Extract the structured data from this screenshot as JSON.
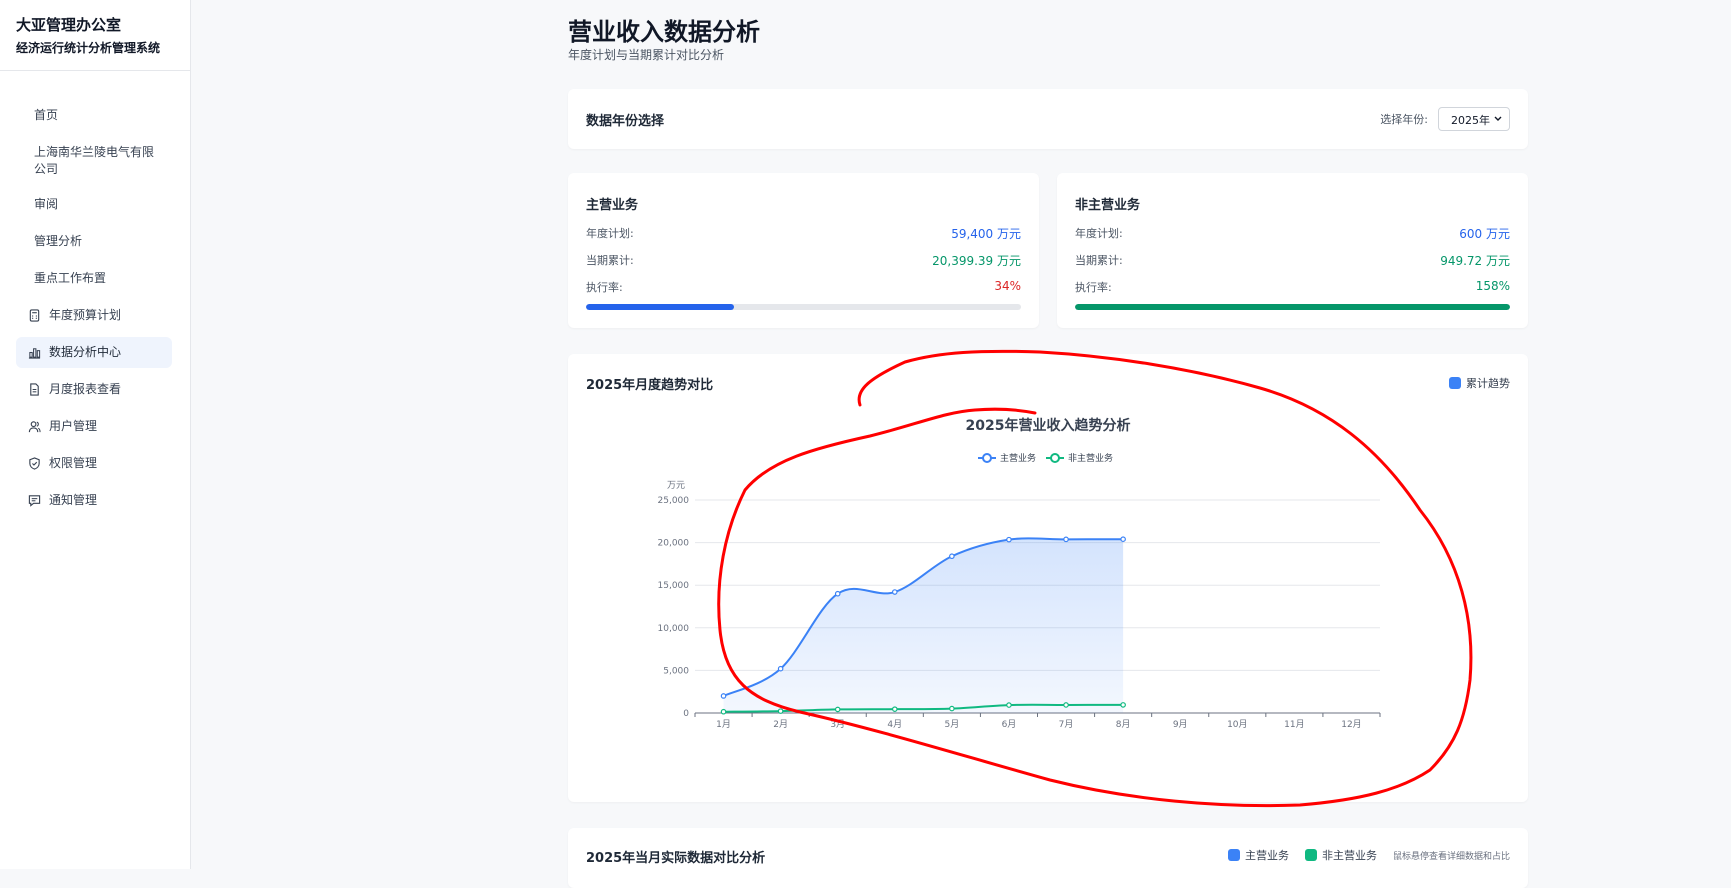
{
  "sidebar": {
    "brand_title": "大亚管理办公室",
    "brand_subtitle": "经济运行统计分析管理系统",
    "items": [
      {
        "label": "首页",
        "icon": null
      },
      {
        "label": "上海南华兰陵电气有限公司",
        "icon": null
      },
      {
        "label": "审阅",
        "icon": null
      },
      {
        "label": "管理分析",
        "icon": null
      },
      {
        "label": "重点工作布置",
        "icon": null
      },
      {
        "label": "年度预算计划",
        "icon": "calculator-icon"
      },
      {
        "label": "数据分析中心",
        "icon": "bar-chart-icon",
        "active": true
      },
      {
        "label": "月度报表查看",
        "icon": "document-icon"
      },
      {
        "label": "用户管理",
        "icon": "users-icon"
      },
      {
        "label": "权限管理",
        "icon": "shield-icon"
      },
      {
        "label": "通知管理",
        "icon": "message-icon"
      }
    ]
  },
  "header": {
    "title": "营业收入数据分析",
    "subtitle": "年度计划与当期累计对比分析"
  },
  "year_selector": {
    "label": "数据年份选择",
    "select_label": "选择年份:",
    "selected": "2025年"
  },
  "stats": [
    {
      "title": "主营业务",
      "plan_label": "年度计划:",
      "plan_value": "59,400 万元",
      "actual_label": "当期累计:",
      "actual_value": "20,399.39 万元",
      "rate_label": "执行率:",
      "rate_value": "34%",
      "progress": 0.34,
      "plan_color": "#2563eb",
      "actual_color": "#059669",
      "rate_color": "#dc2626",
      "bar_color": "#2563eb"
    },
    {
      "title": "非主营业务",
      "plan_label": "年度计划:",
      "plan_value": "600 万元",
      "actual_label": "当期累计:",
      "actual_value": "949.72 万元",
      "rate_label": "执行率:",
      "rate_value": "158%",
      "progress": 1.0,
      "plan_color": "#2563eb",
      "actual_color": "#059669",
      "rate_color": "#059669",
      "bar_color": "#059669"
    }
  ],
  "trend_card": {
    "title": "2025年月度趋势对比",
    "legend_label": "累计趋势",
    "legend_color": "#3b82f6"
  },
  "chart_data": {
    "type": "line",
    "title": "2025年营业收入趋势分析",
    "ylabel": "万元",
    "xlabel": "",
    "categories": [
      "1月",
      "2月",
      "3月",
      "4月",
      "5月",
      "6月",
      "7月",
      "8月",
      "9月",
      "10月",
      "11月",
      "12月"
    ],
    "yticks": [
      "0",
      "5,000",
      "10,000",
      "15,000",
      "20,000",
      "25,000"
    ],
    "ylim": [
      0,
      25000
    ],
    "grid": true,
    "legend_position": "top-center",
    "series": [
      {
        "name": "主营业务",
        "color": "#3b82f6",
        "area": true,
        "values": [
          2000,
          5200,
          14000,
          14200,
          18400,
          20350,
          20380,
          20399.39
        ]
      },
      {
        "name": "非主营业务",
        "color": "#10b981",
        "area": false,
        "values": [
          150,
          220,
          420,
          450,
          520,
          930,
          945,
          949.72
        ]
      }
    ]
  },
  "bottom_card": {
    "title": "2025年当月实际数据对比分析",
    "legend": [
      {
        "label": "主营业务",
        "color": "#3b82f6"
      },
      {
        "label": "非主营业务",
        "color": "#10b981"
      }
    ],
    "hint": "鼠标悬停查看详细数据和占比"
  },
  "annotation_color": "#ff0000"
}
